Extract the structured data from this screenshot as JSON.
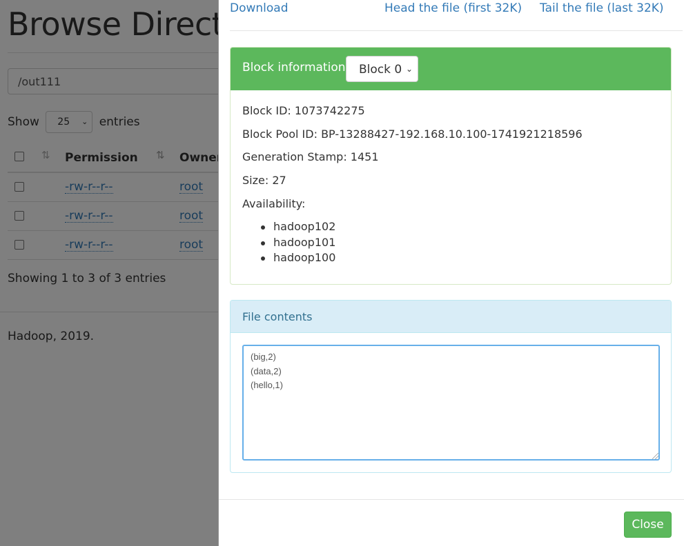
{
  "page": {
    "title": "Browse Director",
    "path_value": "/out111",
    "show_label": "Show",
    "entries_value": "25",
    "entries_label": "entries",
    "table": {
      "headers": {
        "permission": "Permission",
        "owner": "Owner"
      },
      "rows": [
        {
          "permission": "-rw-r--r--",
          "owner": "root"
        },
        {
          "permission": "-rw-r--r--",
          "owner": "root"
        },
        {
          "permission": "-rw-r--r--",
          "owner": "root"
        }
      ]
    },
    "showing_text": "Showing 1 to 3 of 3 entries",
    "footer_text": "Hadoop, 2019."
  },
  "modal": {
    "links": {
      "download": "Download",
      "head": "Head the file (first 32K)",
      "tail": "Tail the file (last 32K)"
    },
    "block_panel": {
      "label": "Block information --",
      "selected_block": "Block 0",
      "block_id": "Block ID: 1073742275",
      "block_pool_id": "Block Pool ID: BP-13288427-192.168.10.100-1741921218596",
      "generation_stamp": "Generation Stamp: 1451",
      "size": "Size: 27",
      "availability_label": "Availability:",
      "availability": [
        "hadoop102",
        "hadoop101",
        "hadoop100"
      ]
    },
    "contents_panel": {
      "label": "File contents",
      "text": "(big,2)\n(data,2)\n(hello,1)"
    },
    "close_label": "Close"
  },
  "colors": {
    "link": "#337ab7",
    "success": "#5cb85c",
    "info_bg": "#d9edf7",
    "info_text": "#31708f"
  }
}
